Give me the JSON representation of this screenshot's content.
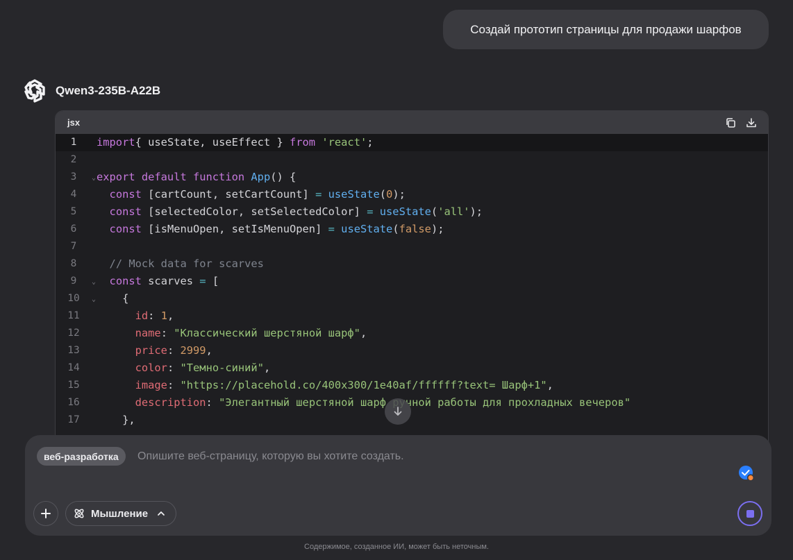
{
  "user_message": "Создай прототип страницы для продажи шарфов",
  "model": {
    "name": "Qwen3-235B-A22B"
  },
  "code_block": {
    "language": "jsx",
    "lines": [
      {
        "n": "1",
        "fold": false,
        "tokens": [
          [
            "kw",
            "import"
          ],
          [
            "",
            "{ useState, useEffect } "
          ],
          [
            "kw",
            "from"
          ],
          [
            "",
            " "
          ],
          [
            "str",
            "'react'"
          ],
          [
            "",
            ";"
          ]
        ]
      },
      {
        "n": "2",
        "fold": false,
        "tokens": []
      },
      {
        "n": "3",
        "fold": true,
        "tokens": [
          [
            "kw",
            "export default function"
          ],
          [
            "",
            " "
          ],
          [
            "fn",
            "App"
          ],
          [
            "",
            "() {"
          ]
        ]
      },
      {
        "n": "4",
        "fold": false,
        "tokens": [
          [
            "",
            "  "
          ],
          [
            "kw",
            "const"
          ],
          [
            "",
            " [cartCount, setCartCount] "
          ],
          [
            "op",
            "="
          ],
          [
            "",
            " "
          ],
          [
            "fn",
            "useState"
          ],
          [
            "",
            "("
          ],
          [
            "num",
            "0"
          ],
          [
            "",
            ");"
          ]
        ]
      },
      {
        "n": "5",
        "fold": false,
        "tokens": [
          [
            "",
            "  "
          ],
          [
            "kw",
            "const"
          ],
          [
            "",
            " [selectedColor, setSelectedColor] "
          ],
          [
            "op",
            "="
          ],
          [
            "",
            " "
          ],
          [
            "fn",
            "useState"
          ],
          [
            "",
            "("
          ],
          [
            "str",
            "'all'"
          ],
          [
            "",
            ");"
          ]
        ]
      },
      {
        "n": "6",
        "fold": false,
        "tokens": [
          [
            "",
            "  "
          ],
          [
            "kw",
            "const"
          ],
          [
            "",
            " [isMenuOpen, setIsMenuOpen] "
          ],
          [
            "op",
            "="
          ],
          [
            "",
            " "
          ],
          [
            "fn",
            "useState"
          ],
          [
            "",
            "("
          ],
          [
            "num",
            "false"
          ],
          [
            "",
            ");"
          ]
        ]
      },
      {
        "n": "7",
        "fold": false,
        "tokens": []
      },
      {
        "n": "8",
        "fold": false,
        "tokens": [
          [
            "",
            "  "
          ],
          [
            "com",
            "// Mock data for scarves"
          ]
        ]
      },
      {
        "n": "9",
        "fold": true,
        "tokens": [
          [
            "",
            "  "
          ],
          [
            "kw",
            "const"
          ],
          [
            "",
            " scarves "
          ],
          [
            "op",
            "="
          ],
          [
            "",
            " ["
          ]
        ]
      },
      {
        "n": "10",
        "fold": true,
        "tokens": [
          [
            "",
            "    {"
          ]
        ]
      },
      {
        "n": "11",
        "fold": false,
        "tokens": [
          [
            "",
            "      "
          ],
          [
            "prop",
            "id"
          ],
          [
            "",
            ": "
          ],
          [
            "num",
            "1"
          ],
          [
            "",
            ","
          ]
        ]
      },
      {
        "n": "12",
        "fold": false,
        "tokens": [
          [
            "",
            "      "
          ],
          [
            "prop",
            "name"
          ],
          [
            "",
            ": "
          ],
          [
            "str",
            "\"Классический шерстяной шарф\""
          ],
          [
            "",
            ","
          ]
        ]
      },
      {
        "n": "13",
        "fold": false,
        "tokens": [
          [
            "",
            "      "
          ],
          [
            "prop",
            "price"
          ],
          [
            "",
            ": "
          ],
          [
            "num",
            "2999"
          ],
          [
            "",
            ","
          ]
        ]
      },
      {
        "n": "14",
        "fold": false,
        "tokens": [
          [
            "",
            "      "
          ],
          [
            "prop",
            "color"
          ],
          [
            "",
            ": "
          ],
          [
            "str",
            "\"Темно-синий\""
          ],
          [
            "",
            ","
          ]
        ]
      },
      {
        "n": "15",
        "fold": false,
        "tokens": [
          [
            "",
            "      "
          ],
          [
            "prop",
            "image"
          ],
          [
            "",
            ": "
          ],
          [
            "str",
            "\"https://placehold.co/400x300/1e40af/ffffff?text= Шарф+1\""
          ],
          [
            "",
            ","
          ]
        ]
      },
      {
        "n": "16",
        "fold": false,
        "tokens": [
          [
            "",
            "      "
          ],
          [
            "prop",
            "description"
          ],
          [
            "",
            ": "
          ],
          [
            "str",
            "\"Элегантный шерстяной шарф ручной работы для прохладных вечеров\""
          ]
        ]
      },
      {
        "n": "17",
        "fold": false,
        "tokens": [
          [
            "",
            "    },"
          ]
        ]
      }
    ]
  },
  "composer": {
    "tag_label": "веб-разработка",
    "placeholder": "Опишите веб-страницу, которую вы хотите создать.",
    "value": "",
    "thinking_label": "Мышление"
  },
  "disclaimer": "Содержимое, созданное ИИ, может быть неточным.",
  "colors": {
    "accent": "#7b6ff0",
    "check_blue": "#2a7fff",
    "badge_orange": "#ff8a3d"
  }
}
